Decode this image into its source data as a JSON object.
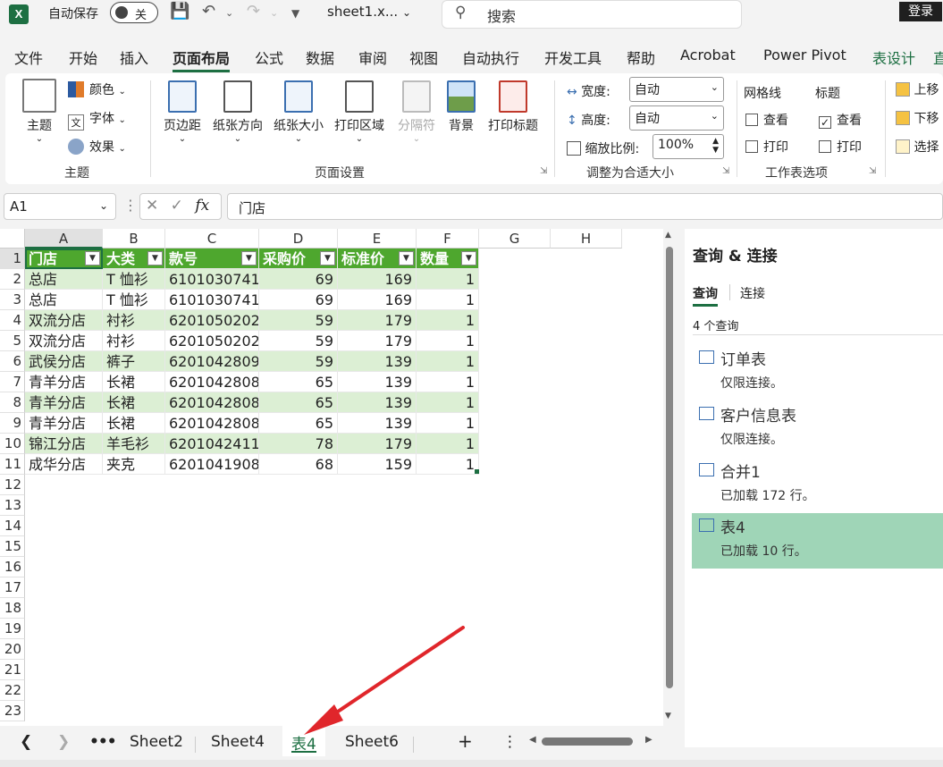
{
  "titlebar": {
    "app_logo": "X",
    "autosave_label": "自动保存",
    "autosave_state": "关",
    "filename": "sheet1.x...",
    "search_placeholder": "搜索",
    "login": "登录"
  },
  "menu": [
    "文件",
    "开始",
    "插入",
    "页面布局",
    "公式",
    "数据",
    "审阅",
    "视图",
    "自动执行",
    "开发工具",
    "帮助",
    "Acrobat",
    "Power Pivot",
    "表设计",
    "直"
  ],
  "menu_active": "页面布局",
  "ribbon": {
    "theme": {
      "btn": "主题",
      "colors": "颜色",
      "fonts": "字体",
      "effects": "效果",
      "group": "主题"
    },
    "page_setup": {
      "margins": "页边距",
      "orientation": "纸张方向",
      "size": "纸张大小",
      "print_area": "打印区域",
      "breaks": "分隔符",
      "background": "背景",
      "print_titles": "打印标题",
      "group": "页面设置"
    },
    "scale": {
      "width_label": "宽度:",
      "width_val": "自动",
      "height_label": "高度:",
      "height_val": "自动",
      "scale_label": "缩放比例:",
      "scale_val": "100%",
      "group": "调整为合适大小"
    },
    "sheet_options": {
      "gridlines": "网格线",
      "headings": "标题",
      "view": "查看",
      "print": "打印",
      "group": "工作表选项"
    },
    "arrange": {
      "bring_forward": "上移",
      "send_backward": "下移",
      "selection": "选择"
    }
  },
  "formula": {
    "namebox": "A1",
    "fx": "fx",
    "content": "门店"
  },
  "grid": {
    "columns": [
      "A",
      "B",
      "C",
      "D",
      "E",
      "F",
      "G",
      "H"
    ],
    "rows": [
      "1",
      "2",
      "3",
      "4",
      "5",
      "6",
      "7",
      "8",
      "9",
      "10",
      "11",
      "12",
      "13",
      "14",
      "15",
      "16",
      "17",
      "18",
      "19",
      "20",
      "21",
      "22",
      "23"
    ],
    "headers": [
      "门店",
      "大类",
      "款号",
      "采购价",
      "标准价",
      "数量"
    ],
    "data": [
      [
        "总店",
        "T 恤衫",
        "6101030741",
        "69",
        "169",
        "1"
      ],
      [
        "总店",
        "T 恤衫",
        "6101030741",
        "69",
        "169",
        "1"
      ],
      [
        "双流分店",
        "衬衫",
        "6201050202",
        "59",
        "179",
        "1"
      ],
      [
        "双流分店",
        "衬衫",
        "6201050202",
        "59",
        "179",
        "1"
      ],
      [
        "武侯分店",
        "裤子",
        "6201042809",
        "59",
        "139",
        "1"
      ],
      [
        "青羊分店",
        "长裙",
        "6201042808",
        "65",
        "139",
        "1"
      ],
      [
        "青羊分店",
        "长裙",
        "6201042808",
        "65",
        "139",
        "1"
      ],
      [
        "青羊分店",
        "长裙",
        "6201042808",
        "65",
        "139",
        "1"
      ],
      [
        "锦江分店",
        "羊毛衫",
        "6201042411",
        "78",
        "179",
        "1"
      ],
      [
        "成华分店",
        "夹克",
        "6201041908",
        "68",
        "159",
        "1"
      ]
    ]
  },
  "panel": {
    "title": "查询 & 连接",
    "tab_queries": "查询",
    "tab_connections": "连接",
    "count": "4 个查询",
    "items": [
      {
        "name": "订单表",
        "status": "仅限连接。"
      },
      {
        "name": "客户信息表",
        "status": "仅限连接。"
      },
      {
        "name": "合并1",
        "status": "已加载 172 行。"
      },
      {
        "name": "表4",
        "status": "已加载 10 行。"
      }
    ]
  },
  "sheets": [
    "Sheet2",
    "Sheet4",
    "表4",
    "Sheet6"
  ],
  "sheet_active": "表4",
  "colors": {
    "excel_green": "#1d6f42",
    "table_header": "#4ea72e",
    "band": "#dcefd4",
    "query_selected": "#9fd5b7",
    "arrow": "#e0262b"
  }
}
